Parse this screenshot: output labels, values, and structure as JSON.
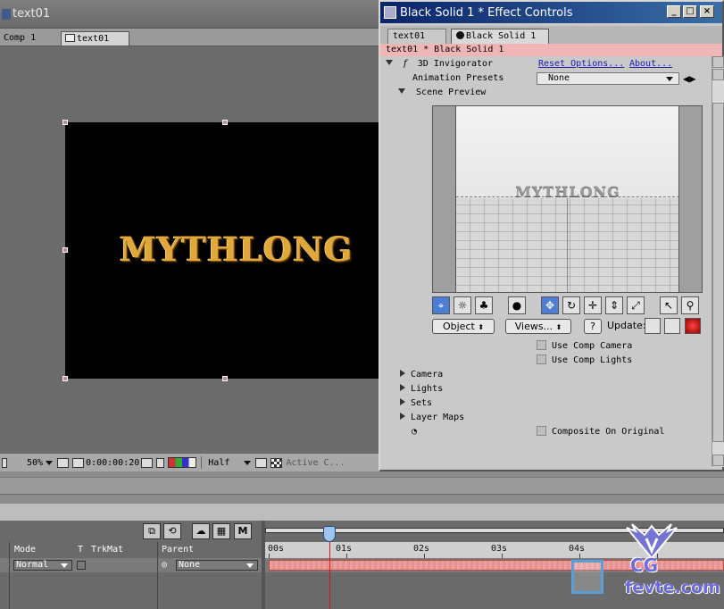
{
  "comp_window": {
    "title": "text01",
    "tabs": [
      "Comp 1",
      "text01"
    ],
    "comp_text": "MYTHLONG",
    "footer": {
      "zoom": "50%",
      "timecode": "0:00:00:20",
      "resolution": "Half",
      "view": "Active C..."
    }
  },
  "effect_controls": {
    "title": "Black Solid 1 * Effect Controls",
    "tabs": [
      "text01",
      "Black Solid 1"
    ],
    "header": "text01 * Black Solid 1",
    "effect": {
      "fx_glyph": "f",
      "name": "3D Invigorator",
      "reset_link": "Reset Options...",
      "about_link": "About...",
      "presets_label": "Animation Presets",
      "presets_value": "None",
      "scene_preview_label": "Scene Preview",
      "preview_text": "MYTHLONG",
      "object_button": "Object",
      "views_button": "Views...",
      "help_button": "?",
      "update_label": "Update:",
      "use_comp_camera": "Use Comp Camera",
      "use_comp_lights": "Use Comp Lights",
      "groups": [
        "Camera",
        "Lights",
        "Sets",
        "Layer Maps"
      ],
      "composite_label": "Composite On Original"
    }
  },
  "timeline": {
    "toolbar_m": "M",
    "columns": {
      "mode": "Mode",
      "t": "T",
      "trkmat": "TrkMat",
      "parent": "Parent"
    },
    "layer": {
      "mode": "Normal",
      "parent": "None"
    },
    "ruler": [
      "00s",
      "01s",
      "02s",
      "03s",
      "04s"
    ]
  },
  "watermark": {
    "logo": "CG",
    "domain": "fevte.com"
  }
}
